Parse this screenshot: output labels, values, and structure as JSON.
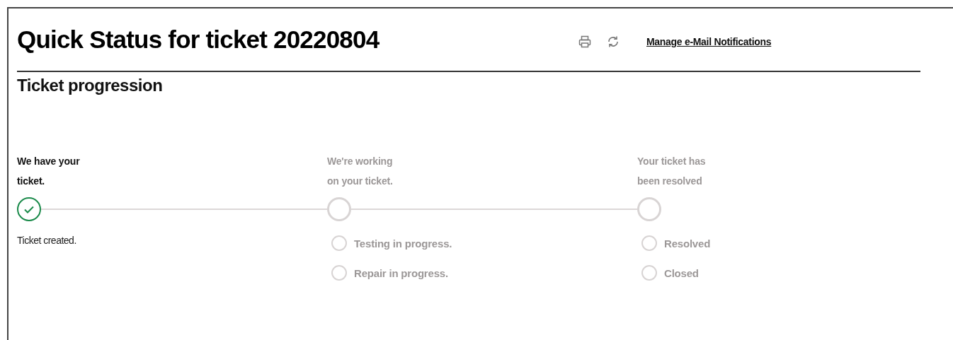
{
  "header": {
    "title": "Quick Status for ticket 20220804",
    "link": "Manage e-Mail Notifications"
  },
  "section": {
    "title": "Ticket progression"
  },
  "steps": [
    {
      "title_lines": [
        "We have your",
        "ticket."
      ],
      "complete": true,
      "items": [
        {
          "label": "Ticket created.",
          "done": true
        }
      ]
    },
    {
      "title_lines": [
        "We're working",
        "on your ticket."
      ],
      "complete": false,
      "items": [
        {
          "label": "Testing in progress.",
          "done": false
        },
        {
          "label": "Repair in progress.",
          "done": false
        }
      ]
    },
    {
      "title_lines": [
        "Your ticket has",
        "been resolved"
      ],
      "complete": false,
      "items": [
        {
          "label": "Resolved",
          "done": false
        },
        {
          "label": "Closed",
          "done": false
        }
      ]
    }
  ]
}
